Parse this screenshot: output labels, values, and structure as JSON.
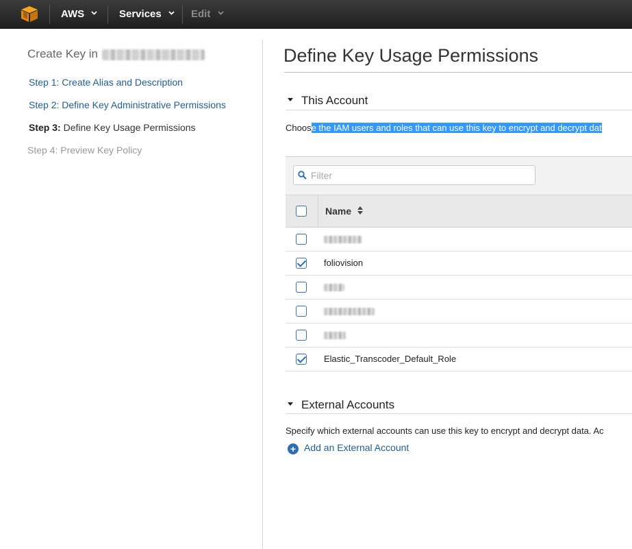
{
  "topnav": {
    "brand": "AWS",
    "services": "Services",
    "edit": "Edit"
  },
  "wizard": {
    "title": "Create Key in",
    "steps": [
      {
        "label": "Step 1: Create Alias and Description"
      },
      {
        "label": "Step 2: Define Key Administrative Permissions"
      },
      {
        "prefix": "Step 3:",
        "label": "Define Key Usage Permissions"
      },
      {
        "label": "Step 4: Preview Key Policy"
      }
    ]
  },
  "main": {
    "title": "Define Key Usage Permissions",
    "this_account": {
      "heading": "This Account",
      "description_plain": "Choos",
      "description_selected": "e the IAM users and roles that can use this key to encrypt and decrypt dat",
      "filter_placeholder": "Filter",
      "column_name": "Name",
      "rows": [
        {
          "name": "",
          "checked": false
        },
        {
          "name": "foliovision",
          "checked": true
        },
        {
          "name": "",
          "checked": false
        },
        {
          "name": "",
          "checked": false
        },
        {
          "name": "",
          "checked": false
        },
        {
          "name": "Elastic_Transcoder_Default_Role",
          "checked": true
        }
      ]
    },
    "external": {
      "heading": "External Accounts",
      "description": "Specify which external accounts can use this key to encrypt and decrypt data. Ac",
      "add_link": "Add an External Account"
    }
  },
  "colors": {
    "link": "#1e5f99",
    "selection": "#3399ff",
    "checkbox": "#2f6db6",
    "logo": "#f7a51a"
  }
}
